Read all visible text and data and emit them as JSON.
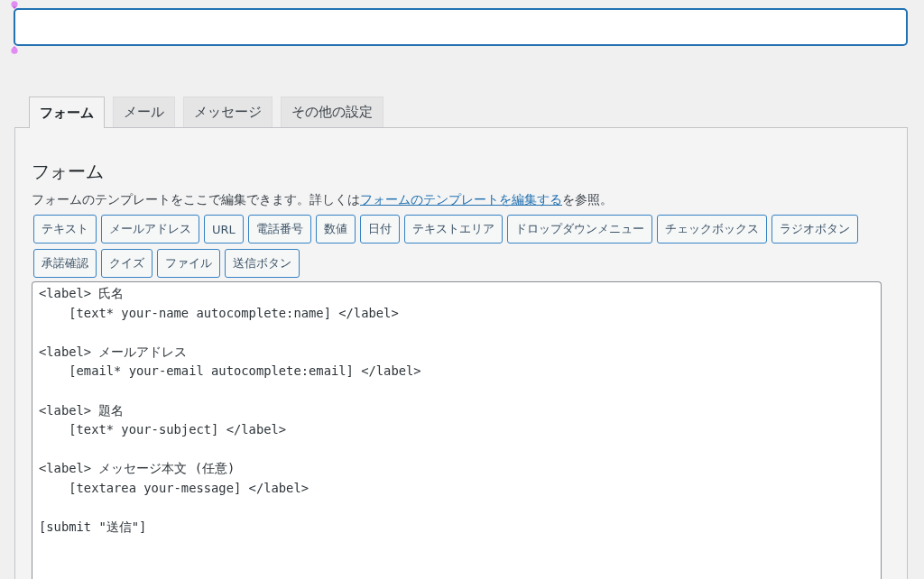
{
  "title_field": {
    "focused": true
  },
  "tabs": [
    {
      "label": "フォーム",
      "selected": true
    },
    {
      "label": "メール",
      "selected": false
    },
    {
      "label": "メッセージ",
      "selected": false
    },
    {
      "label": "その他の設定",
      "selected": false
    }
  ],
  "panel": {
    "heading": "フォーム",
    "description": {
      "before": "フォームのテンプレートをここで編集できます。詳しくは",
      "link": "フォームのテンプレートを編集する",
      "after": "を参照。"
    },
    "tag_buttons": [
      "テキスト",
      "メールアドレス",
      "URL",
      "電話番号",
      "数値",
      "日付",
      "テキストエリア",
      "ドロップダウンメニュー",
      "チェックボックス",
      "ラジオボタン",
      "承諾確認",
      "クイズ",
      "ファイル",
      "送信ボタン"
    ],
    "template": {
      "value": "<label> 氏名\n    [text* your-name autocomplete:name] </label>\n\n<label> メールアドレス\n    [email* your-email autocomplete:email] </label>\n\n<label> 題名\n    [text* your-subject] </label>\n\n<label> メッセージ本文 (任意)\n    [textarea your-message] </label>\n\n[submit \"送信\"]"
    }
  }
}
